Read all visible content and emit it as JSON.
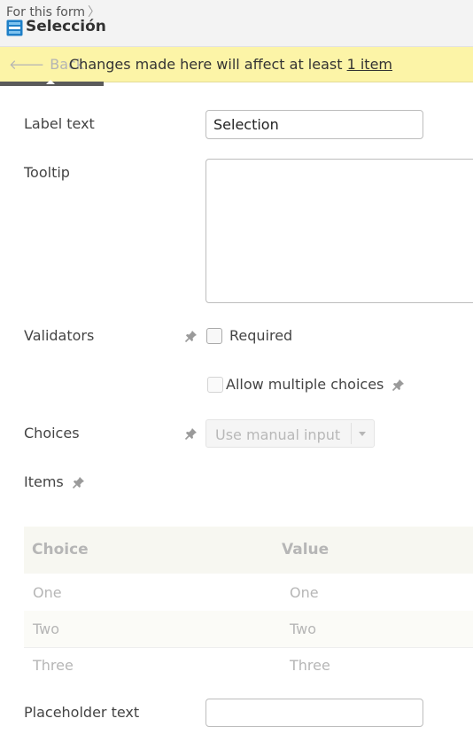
{
  "header": {
    "breadcrumb": "For this form",
    "title": "Selección"
  },
  "warning": {
    "back_label": "Back",
    "message": "Changes made here will affect at least",
    "link_text": "1 item"
  },
  "form": {
    "label_text": {
      "label": "Label text",
      "value": "Selection"
    },
    "tooltip": {
      "label": "Tooltip",
      "value": ""
    },
    "validators": {
      "label": "Validators",
      "required_label": "Required",
      "required_checked": false
    },
    "allow_multiple": {
      "label": "Allow multiple choices",
      "checked": false
    },
    "choices": {
      "label": "Choices",
      "selected": "Use manual input"
    },
    "items": {
      "label": "Items",
      "columns": [
        "Choice",
        "Value"
      ],
      "rows": [
        [
          "One",
          "One"
        ],
        [
          "Two",
          "Two"
        ],
        [
          "Three",
          "Three"
        ]
      ]
    },
    "placeholder": {
      "label": "Placeholder text",
      "value": ""
    }
  },
  "colors": {
    "warning_bg": "#fcf4a7",
    "header_bg": "#f3f3f3",
    "tab_indicator": "#5b5b5b",
    "table_header_bg": "#f7f7f1"
  },
  "icons": [
    "chevron-right-icon",
    "form-field-icon",
    "back-arrow-icon",
    "pin-icon",
    "caret-down-icon"
  ]
}
